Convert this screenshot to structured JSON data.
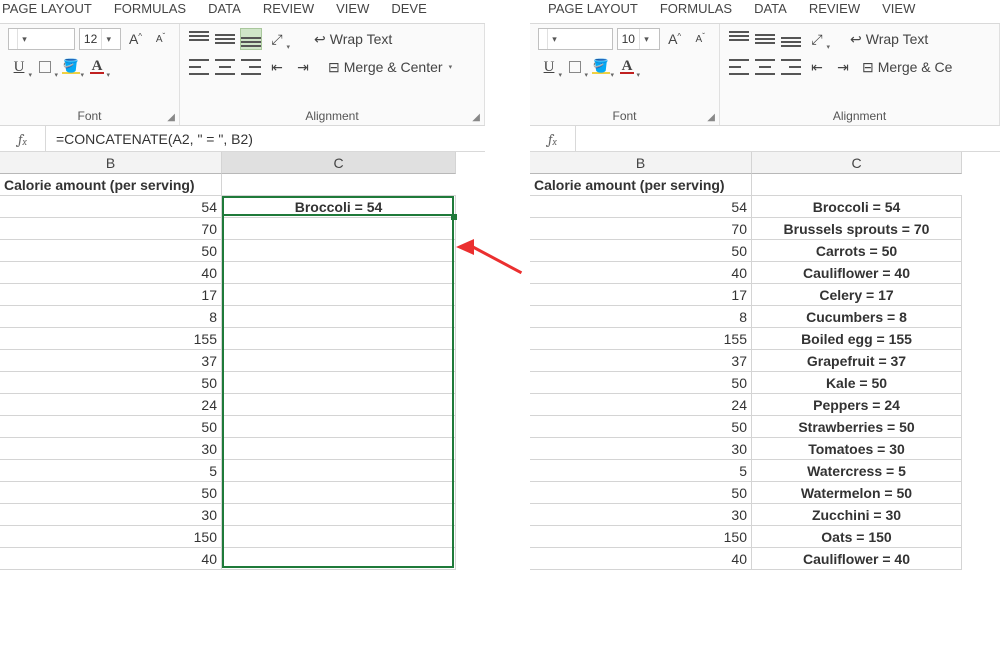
{
  "left": {
    "tabs": [
      "PAGE LAYOUT",
      "FORMULAS",
      "DATA",
      "REVIEW",
      "VIEW",
      "DEVE"
    ],
    "font_size": "12",
    "formula": "=CONCATENATE(A2, \" = \", B2)",
    "group_font": "Font",
    "group_align": "Alignment",
    "wrap": "Wrap Text",
    "merge": "Merge & Center",
    "col_b_label": "B",
    "col_c_label": "C",
    "header_b": "Calorie amount (per serving)",
    "rows": [
      {
        "b": "54",
        "c": "Broccoli = 54"
      },
      {
        "b": "70",
        "c": ""
      },
      {
        "b": "50",
        "c": ""
      },
      {
        "b": "40",
        "c": ""
      },
      {
        "b": "17",
        "c": ""
      },
      {
        "b": "8",
        "c": ""
      },
      {
        "b": "155",
        "c": ""
      },
      {
        "b": "37",
        "c": ""
      },
      {
        "b": "50",
        "c": ""
      },
      {
        "b": "24",
        "c": ""
      },
      {
        "b": "50",
        "c": ""
      },
      {
        "b": "30",
        "c": ""
      },
      {
        "b": "5",
        "c": ""
      },
      {
        "b": "50",
        "c": ""
      },
      {
        "b": "30",
        "c": ""
      },
      {
        "b": "150",
        "c": ""
      },
      {
        "b": "40",
        "c": ""
      }
    ],
    "col_b_w": 222,
    "col_c_w": 234
  },
  "right": {
    "tabs": [
      "PAGE LAYOUT",
      "FORMULAS",
      "DATA",
      "REVIEW",
      "VIEW"
    ],
    "font_size": "10",
    "group_font": "Font",
    "group_align": "Alignment",
    "wrap": "Wrap Text",
    "merge": "Merge & Ce",
    "col_b_label": "B",
    "col_c_label": "C",
    "header_b": "Calorie amount (per serving)",
    "rows": [
      {
        "b": "54",
        "c": "Broccoli = 54"
      },
      {
        "b": "70",
        "c": "Brussels sprouts = 70"
      },
      {
        "b": "50",
        "c": "Carrots = 50"
      },
      {
        "b": "40",
        "c": "Cauliflower = 40"
      },
      {
        "b": "17",
        "c": "Celery = 17"
      },
      {
        "b": "8",
        "c": "Cucumbers = 8"
      },
      {
        "b": "155",
        "c": "Boiled egg = 155"
      },
      {
        "b": "37",
        "c": "Grapefruit = 37"
      },
      {
        "b": "50",
        "c": "Kale = 50"
      },
      {
        "b": "24",
        "c": "Peppers = 24"
      },
      {
        "b": "50",
        "c": "Strawberries = 50"
      },
      {
        "b": "30",
        "c": "Tomatoes = 30"
      },
      {
        "b": "5",
        "c": "Watercress = 5"
      },
      {
        "b": "50",
        "c": "Watermelon = 50"
      },
      {
        "b": "30",
        "c": "Zucchini = 30"
      },
      {
        "b": "150",
        "c": "Oats = 150"
      },
      {
        "b": "40",
        "c": "Cauliflower = 40"
      }
    ],
    "col_b_w": 222,
    "col_c_w": 210
  }
}
